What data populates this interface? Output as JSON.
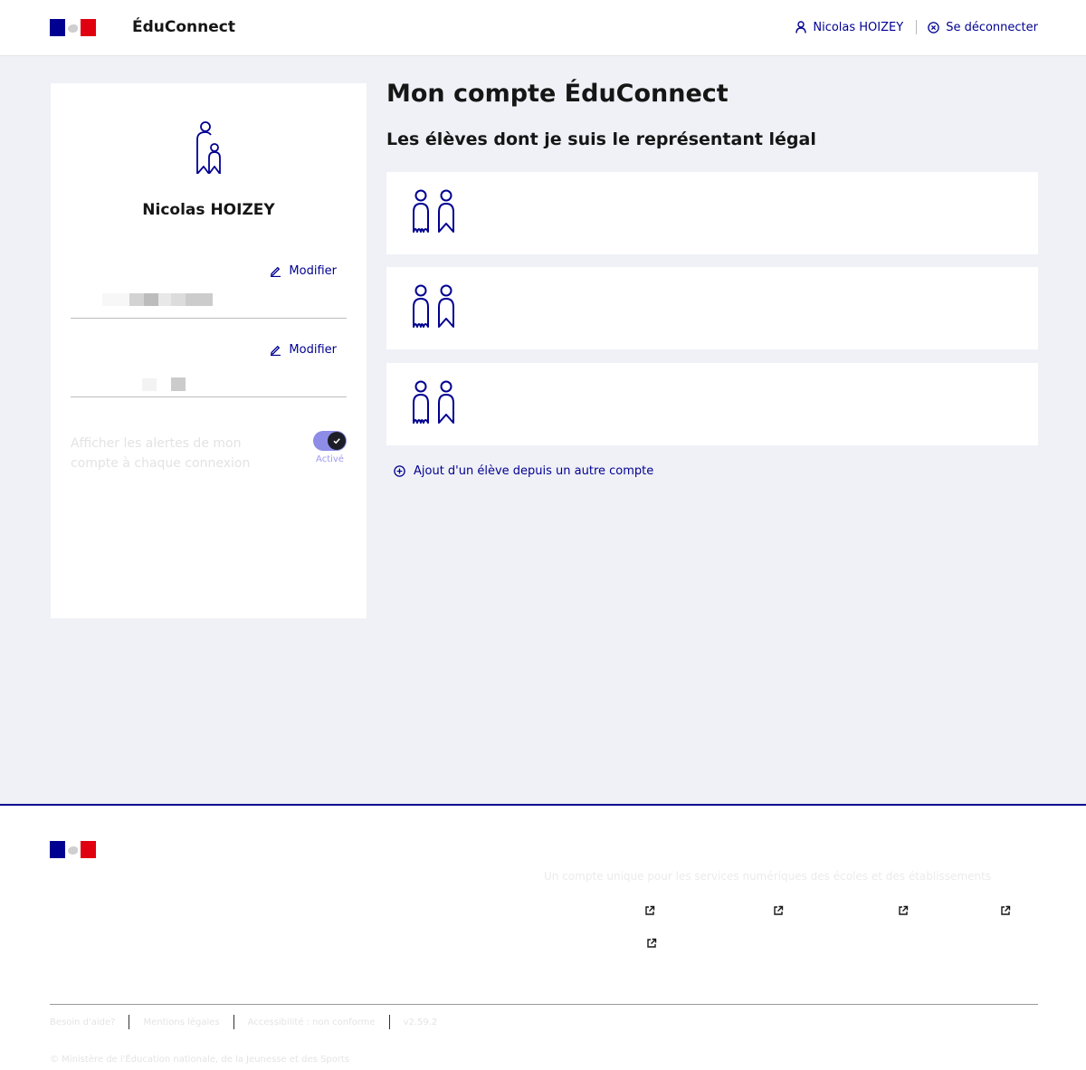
{
  "header": {
    "brand": "ÉduConnect",
    "user_name": "Nicolas HOIZEY",
    "logout_label": "Se déconnecter",
    "icons": {
      "user": "user-icon",
      "logout": "close-circle-icon"
    }
  },
  "profile": {
    "name": "Nicolas HOIZEY",
    "avatar_icon": "parent-child-icon",
    "fields": [
      {
        "modify_label": "Modifier"
      },
      {
        "modify_label": "Modifier"
      }
    ],
    "alerts_label": "Afficher les alertes de mon compte à chaque connexion",
    "alerts_status": "Activé",
    "alerts_on": true
  },
  "main": {
    "title": "Mon compte ÉduConnect",
    "subtitle": "Les élèves dont je suis le représentant légal",
    "students": [
      {
        "icon": "students-icon"
      },
      {
        "icon": "students-icon"
      },
      {
        "icon": "students-icon"
      }
    ],
    "add_label": "Ajout d'un élève depuis un autre compte"
  },
  "footer": {
    "description": "Un compte unique pour les services numériques des écoles et des établissements",
    "links": [
      "Besoin d'aide?",
      "Mentions légales",
      "Accessibilité : non conforme",
      "v2.59.2"
    ],
    "copyright": "© Ministère de l'Éducation nationale, de la Jeunesse et des Sports"
  },
  "colors": {
    "primary": "#000091",
    "page_bg": "#f0f1f6",
    "flag_blue": "#000091",
    "flag_red": "#e1000f",
    "toggle_track": "#8d8ce6"
  }
}
